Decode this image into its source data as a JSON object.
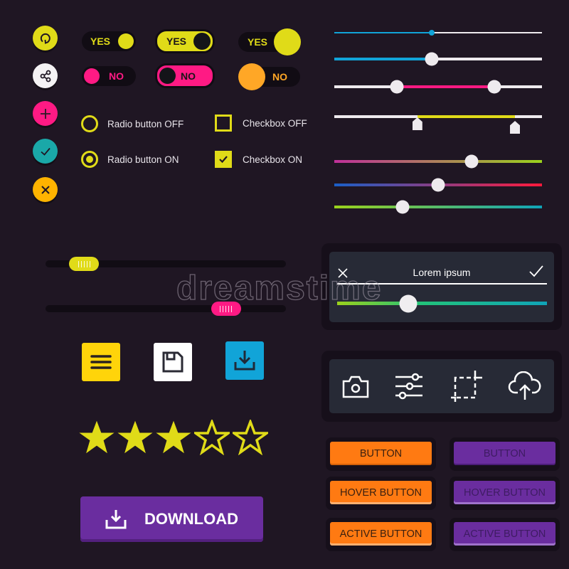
{
  "colors": {
    "background": "#1f1623",
    "yellow": "#e0db18",
    "pink": "#ff1a84",
    "orange": "#ffa726",
    "teal": "#1aa8a8",
    "blue": "#11a4d8",
    "purple": "#6a2d9f",
    "button_orange": "#ff7a12",
    "panel": "#272a36"
  },
  "icon_buttons": [
    {
      "icon": "refresh-icon",
      "color": "#e0db18"
    },
    {
      "icon": "share-icon",
      "color": "#f4f2f4"
    },
    {
      "icon": "plus-icon",
      "color": "#ff1a84"
    },
    {
      "icon": "check-icon",
      "color": "#1aa8a8"
    },
    {
      "icon": "close-icon",
      "color": "#ffb300"
    }
  ],
  "toggles": [
    {
      "label": "YES",
      "state": "on",
      "style": "outline"
    },
    {
      "label": "YES",
      "state": "on",
      "style": "filled"
    },
    {
      "label": "YES",
      "state": "on",
      "style": "big-knob"
    },
    {
      "label": "NO",
      "state": "off",
      "style": "outline"
    },
    {
      "label": "NO",
      "state": "off",
      "style": "filled"
    },
    {
      "label": "NO",
      "state": "off",
      "style": "big-knob"
    }
  ],
  "options": {
    "radio_off": {
      "label": "Radio button OFF",
      "checked": false
    },
    "radio_on": {
      "label": "Radio button ON",
      "checked": true
    },
    "checkbox_off": {
      "label": "Checkbox OFF",
      "checked": false
    },
    "checkbox_on": {
      "label": "Checkbox ON",
      "checked": true
    }
  },
  "sliders": {
    "thin_blue": {
      "value": 0.47
    },
    "blue": {
      "value": 0.47
    },
    "pink_range": {
      "low": 0.3,
      "high": 0.77
    },
    "yellow_range": {
      "low": 0.4,
      "high": 0.87
    },
    "gradient_1": {
      "value": 0.66,
      "from": "#c0309a",
      "to": "#9bd21c"
    },
    "gradient_2": {
      "value": 0.5,
      "from": "#1a5fc8",
      "to": "#ff1a3c"
    },
    "gradient_3": {
      "value": 0.33,
      "from": "#9bd21c",
      "to": "#10a4b8"
    },
    "dark_yellow": {
      "value": 0.16
    },
    "dark_pink": {
      "value": 0.75
    }
  },
  "dialog": {
    "title": "Lorem ipsum",
    "slider_value": 0.34
  },
  "square_buttons": [
    {
      "icon": "menu-icon",
      "color": "#ffd40a"
    },
    {
      "icon": "save-icon",
      "color": "#ffffff"
    },
    {
      "icon": "download-icon",
      "color": "#11a4d8"
    }
  ],
  "toolbar_icons": [
    "camera-icon",
    "sliders-icon",
    "crop-icon",
    "cloud-upload-icon"
  ],
  "rating": {
    "value": 3,
    "max": 5
  },
  "download_button": {
    "label": "DOWNLOAD"
  },
  "buttons": {
    "orange": [
      "BUTTON",
      "HOVER BUTTON",
      "ACTIVE BUTTON"
    ],
    "purple": [
      "BUTTON",
      "HOVER BUTTON",
      "ACTIVE BUTTON"
    ]
  },
  "watermark": "dreamstime"
}
